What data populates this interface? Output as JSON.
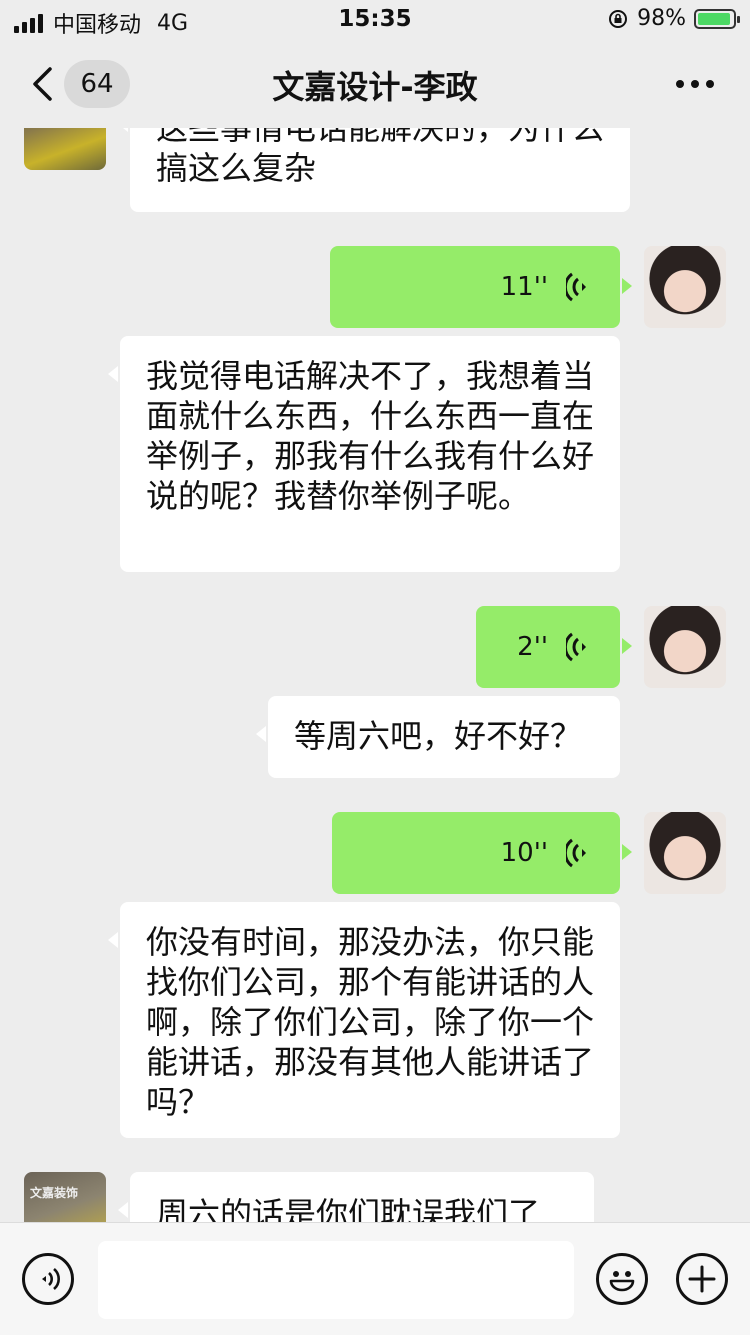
{
  "status_bar": {
    "carrier": "中国移动",
    "network": "4G",
    "time": "15:35",
    "battery": "98%"
  },
  "nav": {
    "badge_count": "64",
    "title": "文嘉设计-李政"
  },
  "messages": [
    {
      "side": "left",
      "type": "text",
      "text": "这些事情电话能解决的，为什么搞这么复杂"
    },
    {
      "side": "right",
      "type": "voice",
      "duration": "11''"
    },
    {
      "side": "left",
      "type": "text",
      "text": "我觉得电话解决不了，我想着当面就什么东西，什么东西一直在举例子，那我有什么我有什么好说的呢？我替你举例子呢。"
    },
    {
      "side": "right",
      "type": "voice",
      "duration": "2''"
    },
    {
      "side": "left",
      "type": "text",
      "text": "等周六吧，好不好？"
    },
    {
      "side": "right",
      "type": "voice",
      "duration": "10''"
    },
    {
      "side": "left",
      "type": "text",
      "text": "你没有时间，那没办法，你只能找你们公司，那个有能讲话的人啊，除了你们公司，除了你一个能讲话，那没有其他人能讲话了吗？"
    },
    {
      "side": "left",
      "type": "text",
      "text": "周六的话是你们耽误我们了"
    }
  ],
  "avatar_left_label": "文嘉装饰",
  "icons": {
    "back": "chevron-left-icon",
    "more": "more-icon",
    "voice_input": "voice-input-icon",
    "emoji": "emoji-icon",
    "add": "plus-icon"
  },
  "colors": {
    "sent_bubble": "#95ec69",
    "received_bubble": "#ffffff",
    "background": "#ededed"
  }
}
